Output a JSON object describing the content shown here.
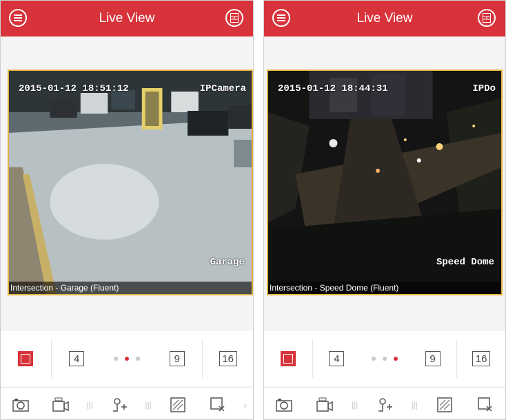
{
  "colors": {
    "accent": "#d8323a",
    "video_border": "#e3b23c"
  },
  "screens": [
    {
      "header": {
        "title": "Live View",
        "menu_icon": "menu-icon",
        "split_icon": "window-split-icon"
      },
      "video": {
        "timestamp": "2015-01-12 18:51:12",
        "camera_label": "IPCamera",
        "name_overlay": "Garage",
        "caption": "Intersection - Garage (Fluent)"
      },
      "grid": {
        "options": [
          "1",
          "4",
          "9",
          "16"
        ],
        "selected": "1",
        "active_page": 1
      },
      "toolbar": [
        "camera-snapshot-icon",
        "record-icon",
        "ptz-icon",
        "image-quality-icon",
        "close-all-icon"
      ]
    },
    {
      "header": {
        "title": "Live View",
        "menu_icon": "menu-icon",
        "split_icon": "window-split-icon"
      },
      "video": {
        "timestamp": "2015-01-12 18:44:31",
        "camera_label": "IPDo",
        "name_overlay": "Speed Dome",
        "caption": "Intersection - Speed Dome (Fluent)"
      },
      "grid": {
        "options": [
          "1",
          "4",
          "9",
          "16"
        ],
        "selected": "1",
        "active_page": 2
      },
      "toolbar": [
        "camera-snapshot-icon",
        "record-icon",
        "ptz-icon",
        "image-quality-icon",
        "close-all-icon"
      ]
    }
  ]
}
